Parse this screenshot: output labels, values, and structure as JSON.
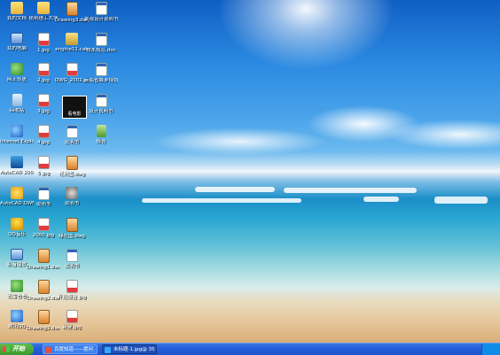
{
  "desktop": {
    "icons": [
      {
        "label": "我的文档",
        "glyph": "folder-icon"
      },
      {
        "label": "我的电脑",
        "glyph": "computer-icon"
      },
      {
        "label": "网上邻居",
        "glyph": "network-icon"
      },
      {
        "label": "回收站",
        "glyph": "recycle-bin-icon"
      },
      {
        "label": "Internet Explorer",
        "glyph": "ie-icon"
      },
      {
        "label": "AutoCAD 2007 - Simplif",
        "glyph": "autocad-icon"
      },
      {
        "label": "AutoCAD DWF Viewer",
        "glyph": "app-icon"
      },
      {
        "label": "QQ音乐",
        "glyph": "qq-icon"
      },
      {
        "label": "影音播放",
        "glyph": "app-icon"
      },
      {
        "label": "迅雷看看",
        "glyph": "app-icon"
      },
      {
        "label": "腾讯QQ",
        "glyph": "qq-icon"
      },
      {
        "label": "昆明理工大学",
        "glyph": "folder-icon"
      },
      {
        "label": "1.jpg",
        "glyph": "image-icon"
      },
      {
        "label": "2.jpg",
        "glyph": "image-icon"
      },
      {
        "label": "3.jpg",
        "glyph": "image-icon"
      },
      {
        "label": "4.jpg",
        "glyph": "image-icon"
      },
      {
        "label": "5.jpg",
        "glyph": "image-icon"
      },
      {
        "label": "3000.jpg",
        "glyph": "image-icon"
      },
      {
        "label": "2000.jpg",
        "glyph": "image-icon"
      },
      {
        "label": "Drawing1.dwg",
        "glyph": "dwg-icon"
      },
      {
        "label": "Drawing2.dwg",
        "glyph": "dwg-icon"
      },
      {
        "label": "Drawing3.dwg",
        "glyph": "dwg-icon"
      },
      {
        "label": "engine11.cab",
        "glyph": "cab-icon"
      },
      {
        "label": "DWG_2002.pdf",
        "glyph": "image-icon"
      },
      {
        "label": "电影",
        "glyph": "movie-icon"
      },
      {
        "label": "说明书",
        "glyph": "document-icon"
      },
      {
        "label": "视频图.dwg",
        "glyph": "dwg-icon"
      },
      {
        "label": "说明书",
        "glyph": "settings-icon"
      },
      {
        "label": "绿化图.dwg",
        "glyph": "dwg-icon"
      },
      {
        "label": "说明书",
        "glyph": "document-icon"
      },
      {
        "label": "开题报告.jpg",
        "glyph": "image-icon"
      },
      {
        "label": "新建.jpg",
        "glyph": "image-icon"
      },
      {
        "label": "景观设计说明书",
        "glyph": "document-icon"
      },
      {
        "label": "技术规范.doc",
        "glyph": "document-icon"
      },
      {
        "label": "云南省城乡规划条例",
        "glyph": "document-icon"
      },
      {
        "label": "设计说明书",
        "glyph": "document-icon"
      },
      {
        "label": "报告",
        "glyph": "database-icon"
      }
    ],
    "movie_label": "看电影"
  },
  "taskbar": {
    "start_label": "开始",
    "tasks": [
      {
        "label": "百度知道——提问"
      },
      {
        "label": "未标题-1.jpg@ 35"
      }
    ]
  },
  "colors": {
    "taskbar": "#245edb",
    "start": "#3a9a2a"
  }
}
